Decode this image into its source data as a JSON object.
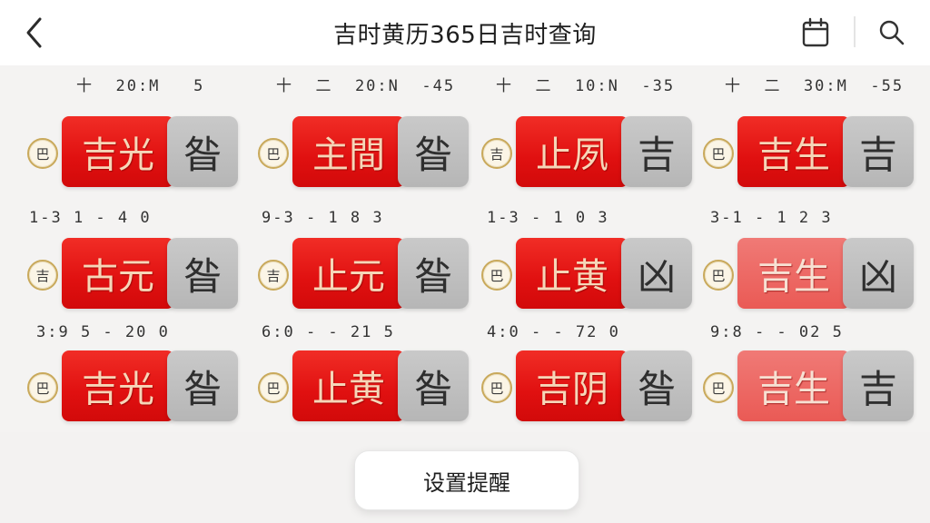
{
  "header": {
    "title": "吉时黄历365日吉时查询",
    "back_icon": "chevron-left-icon",
    "calendar_icon": "calendar-icon",
    "search_icon": "search-icon"
  },
  "rows": [
    {
      "cells": [
        {
          "time": "十  20:M   5",
          "badge": "巴",
          "main": "吉光",
          "status": "昝"
        },
        {
          "time": "十  二  20:N  -45",
          "badge": "巴",
          "main": "主間",
          "status": "昝"
        },
        {
          "time": "十  二  10:N  -35",
          "badge": "吉",
          "main": "止夙",
          "status": "吉"
        },
        {
          "time": "十  二  30:M  -55",
          "badge": "巴",
          "main": "吉生",
          "status": "吉"
        }
      ]
    },
    {
      "cells": [
        {
          "time": "1-3 1 - 4 0",
          "badge": "吉",
          "main": "古元",
          "status": "昝"
        },
        {
          "time": "9-3 - 1 8 3",
          "badge": "吉",
          "main": "止元",
          "status": "昝"
        },
        {
          "time": "1-3 - 1 0 3",
          "badge": "巴",
          "main": "止黄",
          "status": "凶"
        },
        {
          "time": "3-1 - 1 2 3",
          "badge": "巴",
          "main": "吉生",
          "status": "凶"
        }
      ]
    },
    {
      "cells": [
        {
          "time": "3:9 5 - 20 0",
          "badge": "巴",
          "main": "吉光",
          "status": "昝"
        },
        {
          "time": "6:0 - - 21 5",
          "badge": "巴",
          "main": "止黄",
          "status": "昝"
        },
        {
          "time": "4:0 - - 72 0",
          "badge": "巴",
          "main": "吉阴",
          "status": "昝"
        },
        {
          "time": "9:8 - - 02 5",
          "badge": "巴",
          "main": "吉生",
          "status": "吉"
        }
      ]
    }
  ],
  "bottom": {
    "reminder_label": "设置提醒"
  },
  "colors": {
    "accent_red": "#e01010",
    "tile_grey": "#bdbdbd",
    "badge_gold": "#c9a95b"
  }
}
